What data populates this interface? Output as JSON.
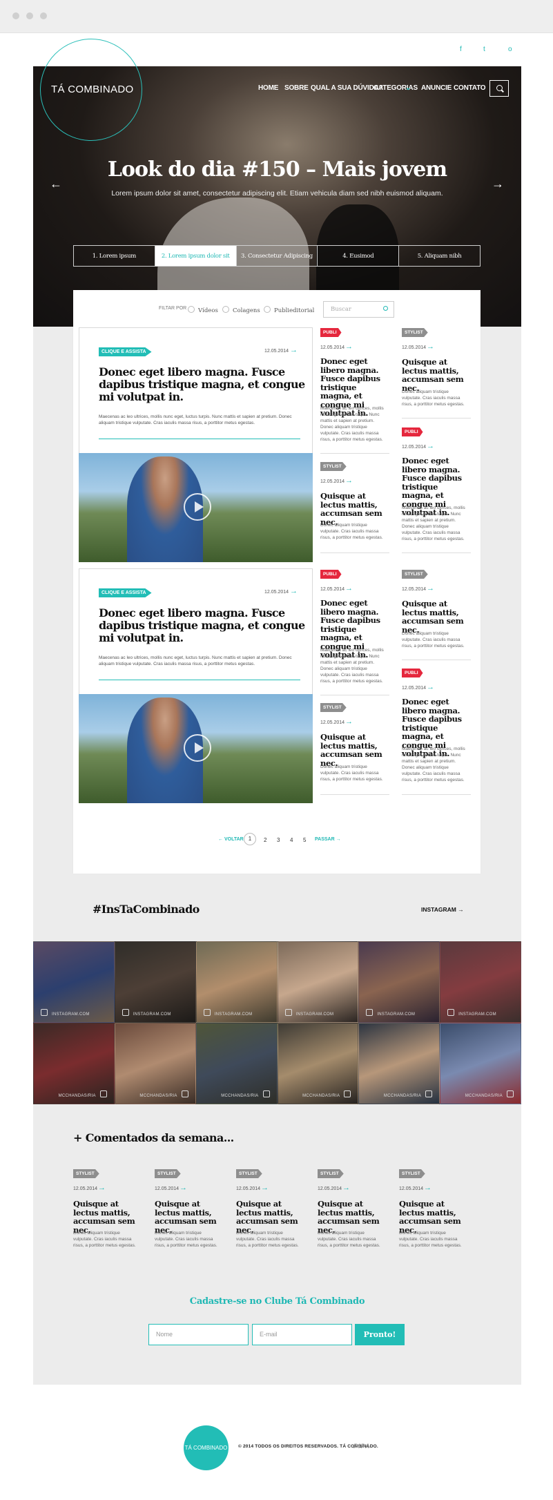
{
  "social": {
    "facebook": "f",
    "twitter": "t",
    "instagram": "o"
  },
  "brand": {
    "name": "TÁ COMBINADO"
  },
  "nav": {
    "items": [
      "HOME",
      "SOBRE",
      "QUAL A SUA DÚVIDA?",
      "CATEGORIAS",
      "ANUNCIE",
      "CONTATO"
    ]
  },
  "hero": {
    "title": "Look do dia #150 – Mais jovem",
    "subtitle": "Lorem ipsum dolor sit amet, consectetur adipiscing elit. Etiam vehicula diam sed nibh euismod aliquam.",
    "tabs": [
      "1. Lorem ipsum",
      "2. Lorem ipsum dolor sit",
      "3. Consectetur Adipiscing",
      "4. Eusimod",
      "5. Aliquam nibh"
    ],
    "active_tab": 1
  },
  "filter": {
    "label": "FILTAR POR",
    "options": [
      "Vídeos",
      "Colagens",
      "Publieditorial"
    ],
    "search_placeholder": "Buscar"
  },
  "featured": [
    {
      "badge": "CLIQUE E ASSISTA",
      "date": "12.05.2014",
      "title": "Donec eget libero magna. Fusce dapibus tristique magna, et congue mi volutpat in.",
      "text": "Maecenas ac leo ultrices, mollis nunc eget, luctus turpis. Nunc mattis et sapien at pretium. Donec aliquam tristique vulputate. Cras iaculis massa risus, a porttitor metus egestas."
    },
    {
      "badge": "CLIQUE E ASSISTA",
      "date": "12.05.2014",
      "title": "Donec eget libero magna. Fusce dapibus tristique magna, et congue mi volutpat in.",
      "text": "Maecenas ac leo ultrices, mollis nunc eget, luctus turpis. Nunc mattis et sapien at pretium. Donec aliquam tristique vulputate. Cras iaculis massa risus, a porttitor metus egestas."
    }
  ],
  "publi": {
    "tag": "PUBLI",
    "date": "12.05.2014",
    "title": "Donec eget libero magna. Fusce dapibus tristique magna, et congue mi volutpat in.",
    "text": "Maecenas ac leo ultrices, mollis nunc eget, luctus turpis. Nunc mattis et sapien at pretium. Donec aliquam tristique vulputate. Cras iaculis massa risus, a porttitor metus egestas."
  },
  "stylist": {
    "tag": "STYLIST",
    "date": "12.05.2014",
    "title": "Quisque at lectus mattis, accumsan sem nec.",
    "text": "Donec aliquam tristique vulputate. Cras iaculis massa risus, a porttitor metus egestas."
  },
  "pagination": {
    "prev": "VOLTAR",
    "pages": [
      "1",
      "2",
      "3",
      "4",
      "5"
    ],
    "next": "PASSAR"
  },
  "instagram": {
    "heading": "#InsTaCombinado",
    "link": "INSTAGRAM →",
    "handle_top": "INSTAGRAM.COM",
    "handle_bottom": "MCCHANDAS/RIA"
  },
  "comments": {
    "heading": "+ Comentados da semana..."
  },
  "newsletter": {
    "heading": "Cadastre-se no Clube Tá Combinado",
    "name_placeholder": "Nome",
    "email_placeholder": "E-mail",
    "button": "Pronto!"
  },
  "footer": {
    "logo": "TÁ COMBINADO",
    "copyright": "© 2014 TODOS OS DIREITOS RESERVADOS. TÁ COMBINADO.",
    "credit": "PIPA"
  },
  "colors": {
    "accent": "#22bdb6",
    "publi": "#e5273d",
    "stylist": "#8e8e8e",
    "background": "#ececec"
  }
}
